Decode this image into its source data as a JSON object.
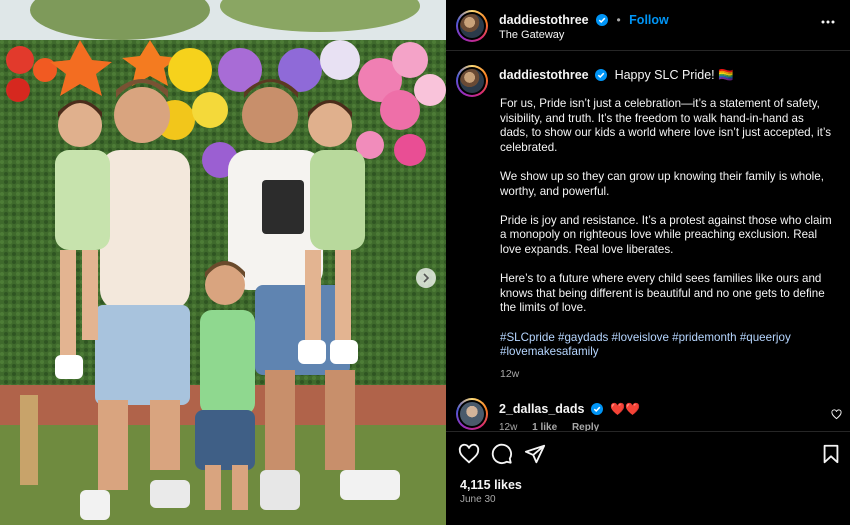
{
  "post": {
    "username": "daddiestothree",
    "follow_label": "Follow",
    "separator": "•",
    "location": "The Gateway",
    "caption_title": "Happy SLC Pride! 🏳️‍🌈",
    "caption_paragraphs": [
      "For us, Pride isn’t just a celebration—it’s a statement of safety, visibility, and truth. It’s the freedom to walk hand-in-hand as dads, to show our kids a world where love isn’t just accepted, it’s celebrated.",
      "We show up so they can grow up knowing their family is whole, worthy, and powerful.",
      "Pride is joy and resistance. It’s a protest against those who claim a monopoly on righteous love while preaching exclusion. Real love expands. Real love liberates.",
      "Here’s to a future where every child sees families like ours and knows that being different is beautiful and no one gets to define the limits of love."
    ],
    "hashtags": [
      "#SLCpride",
      "#gaydads",
      "#loveislove",
      "#pridemonth",
      "#queerjoy",
      "#lovemakesafamily"
    ],
    "caption_time": "12w",
    "likes": "4,115 likes",
    "date": "June 30"
  },
  "comment": {
    "username": "2_dallas_dads",
    "text": "❤️❤️",
    "time": "12w",
    "likes_label": "1 like",
    "reply_label": "Reply"
  },
  "colors": {
    "accent": "#0095f6",
    "hashtag": "#b6d6ff",
    "muted": "#a8a8a8",
    "verified": "#0095f6"
  },
  "icons": [
    "more-icon",
    "verified-icon",
    "heart-icon",
    "comment-icon",
    "share-icon",
    "save-icon",
    "chevron-right-icon"
  ]
}
